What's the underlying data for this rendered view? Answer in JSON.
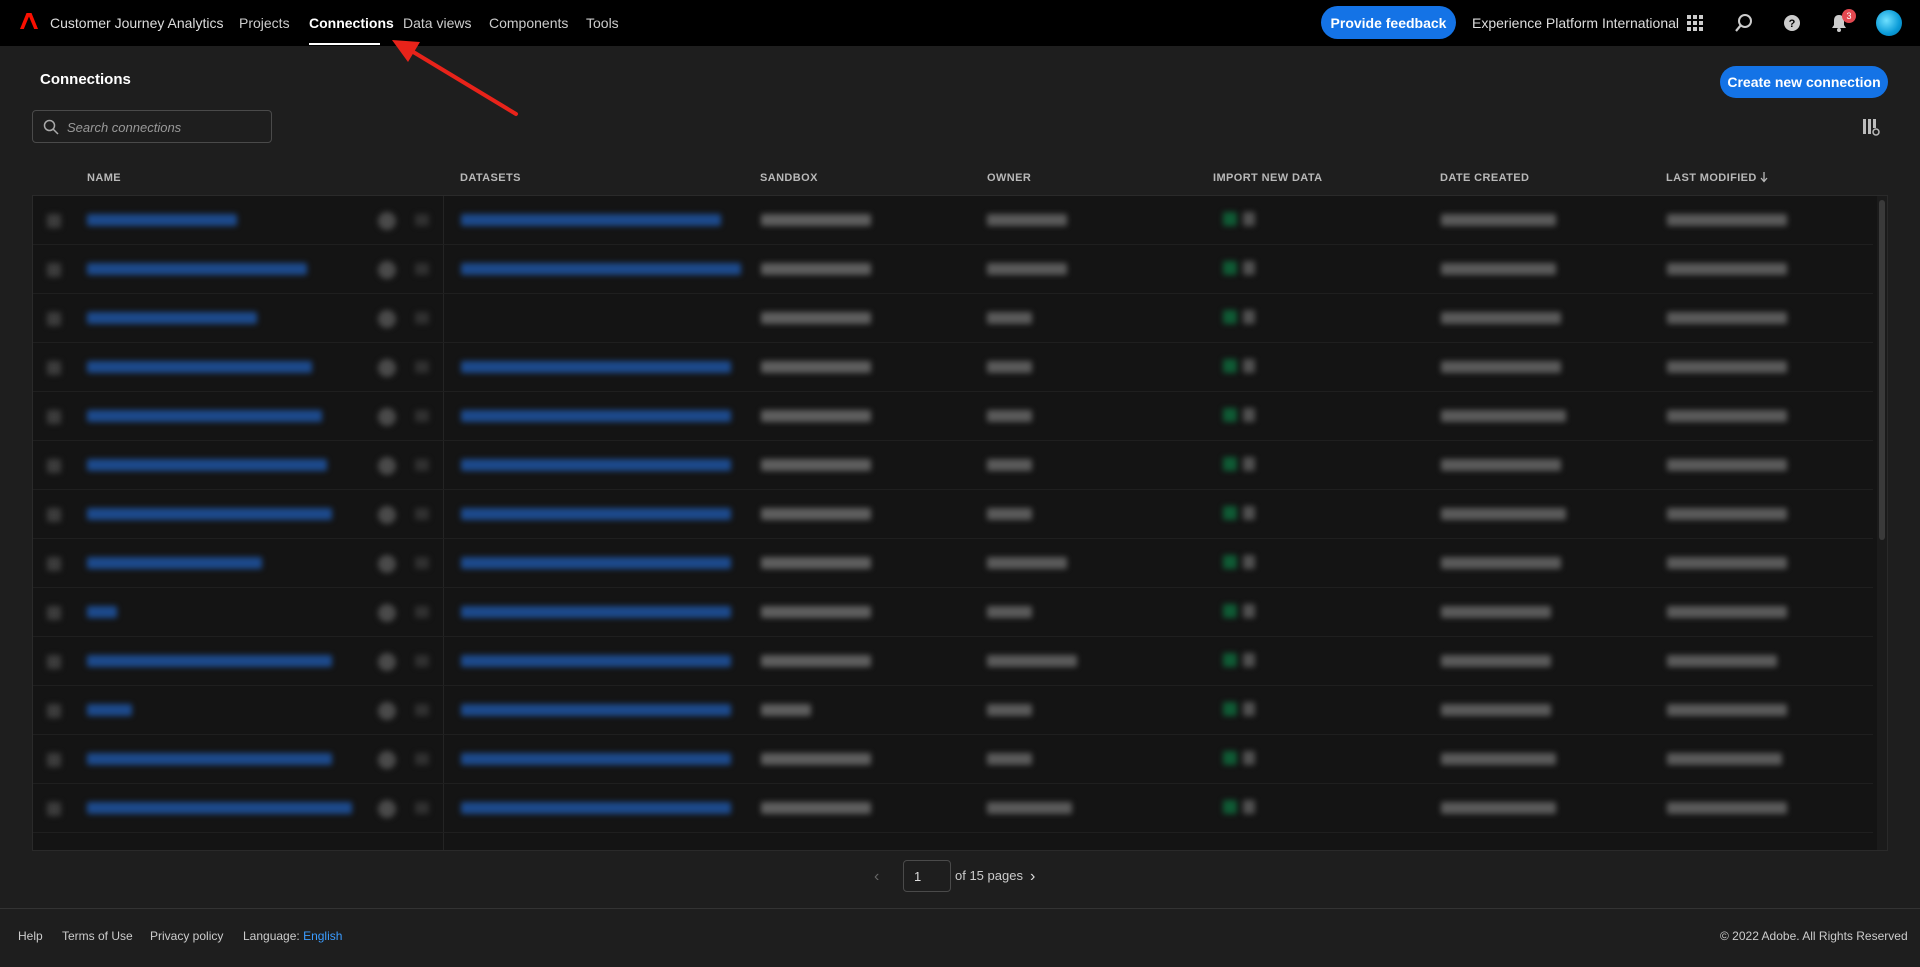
{
  "header": {
    "app_title": "Customer Journey Analytics",
    "nav": [
      {
        "label": "Projects"
      },
      {
        "label": "Connections",
        "active": true
      },
      {
        "label": "Data views"
      },
      {
        "label": "Components"
      },
      {
        "label": "Tools"
      }
    ],
    "feedback_label": "Provide feedback",
    "org_name": "Experience Platform International",
    "notification_count": "3",
    "accent_color": "#1473e6",
    "icons": [
      "adobe-logo",
      "apps-grid-icon",
      "search-icon",
      "help-icon",
      "bell-icon",
      "avatar"
    ]
  },
  "page": {
    "title": "Connections",
    "create_label": "Create new connection",
    "search_placeholder": "Search connections"
  },
  "table": {
    "columns": [
      "NAME",
      "DATASETS",
      "SANDBOX",
      "OWNER",
      "IMPORT NEW DATA",
      "DATE CREATED",
      "LAST MODIFIED"
    ],
    "sort_column": "LAST MODIFIED",
    "sort_direction": "descending",
    "rows_visible": 13,
    "content_note": "row contents blurred/redacted in screenshot"
  },
  "pagination": {
    "current_page": "1",
    "total_label": "of 15 pages"
  },
  "footer": {
    "help": "Help",
    "terms": "Terms of Use",
    "privacy": "Privacy policy",
    "language_label": "Language:",
    "language_value": "English",
    "copyright": "© 2022 Adobe. All Rights Reserved"
  },
  "annotation": {
    "arrow_color": "#e8231a"
  }
}
